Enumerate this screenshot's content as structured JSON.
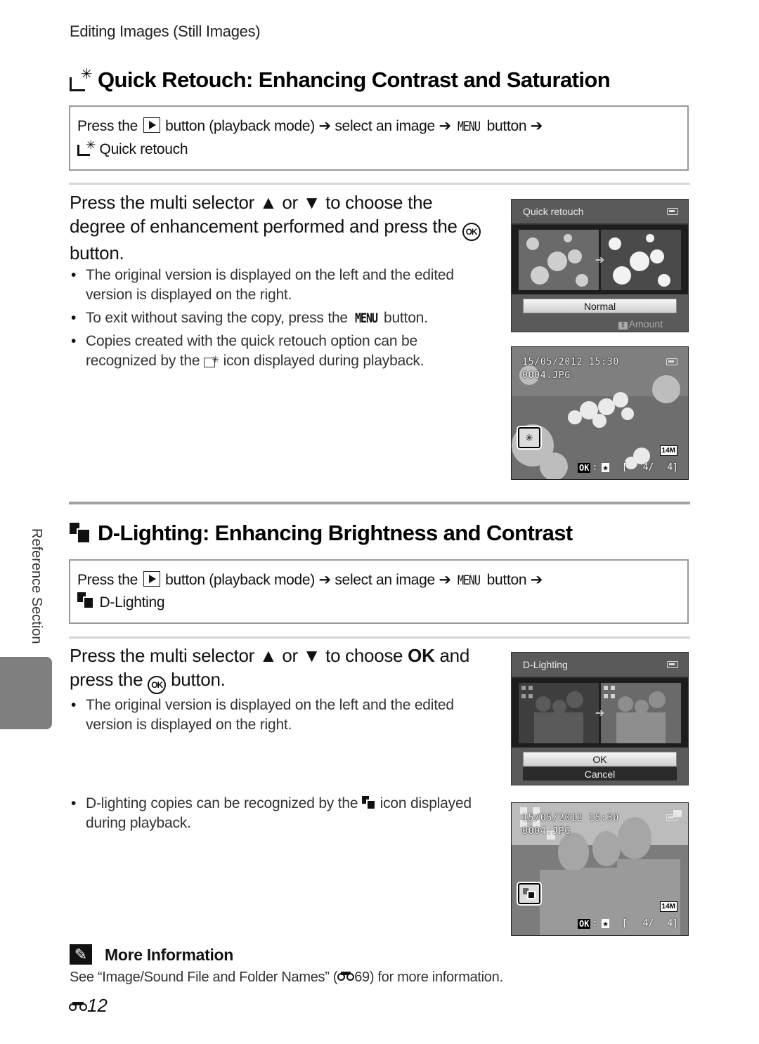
{
  "running_head": "Editing Images (Still Images)",
  "side_tab": {
    "label": "Reference Section",
    "color": "#7f7f7f"
  },
  "sections": [
    {
      "title": "Quick Retouch: Enhancing Contrast and Saturation",
      "title_icon": "quick-retouch-icon",
      "path": {
        "prefix": "Press the",
        "play_icon": "playback-button-icon",
        "part1": "button (playback mode)",
        "arrow": "➔",
        "part2": "select an image",
        "menu_word": "MENU",
        "part3": "button",
        "final_item": "Quick retouch"
      },
      "step": {
        "text_a": "Press the multi selector",
        "up": "▲",
        "or": "or",
        "down": "▼",
        "text_b": "to choose the degree of enhancement performed and press the",
        "ok": "OK",
        "text_c": "button."
      },
      "bullets": [
        {
          "text": "The original version is displayed on the left and the edited version is displayed on the right."
        },
        {
          "before": "To exit without saving the copy, press the",
          "menu_word": "MENU",
          "after": "button."
        },
        {
          "before": "Copies created with the quick retouch option can be recognized by the",
          "icon": "quick-retouch-playback-icon",
          "after": "icon displayed during playback."
        }
      ],
      "lcd_menu": {
        "title": "Quick retouch",
        "option": "Normal",
        "hint_icon": "up-down-icon",
        "hint": "Amount"
      },
      "playback": {
        "datetime": "15/05/2012 15:30",
        "filename": "0004.JPG",
        "image_size": "14M",
        "ok_label": "OK",
        "counter_open": "[",
        "counter_current": "4/",
        "counter_total": "4]"
      }
    },
    {
      "title": "D-Lighting: Enhancing Brightness and Contrast",
      "title_icon": "d-lighting-icon",
      "path": {
        "prefix": "Press the",
        "play_icon": "playback-button-icon",
        "part1": "button (playback mode)",
        "arrow": "➔",
        "part2": "select an image",
        "menu_word": "MENU",
        "part3": "button",
        "final_item": "D-Lighting"
      },
      "step": {
        "text_a": "Press the multi selector",
        "up": "▲",
        "or": "or",
        "down": "▼",
        "text_b": "to choose",
        "bold": "OK",
        "text_c": "and press the",
        "ok": "OK",
        "text_d": "button."
      },
      "bullets": [
        {
          "text": "The original version is displayed on the left and the edited version is displayed on the right."
        },
        {
          "before": "D-lighting copies can be recognized by the",
          "icon": "d-lighting-playback-icon",
          "after": "icon displayed during playback."
        }
      ],
      "lcd_menu": {
        "title": "D-Lighting",
        "options": [
          "OK",
          "Cancel"
        ],
        "selected": "OK"
      },
      "playback": {
        "datetime": "15/05/2012 15:30",
        "filename": "0004.JPG",
        "image_size": "14M",
        "ok_label": "OK",
        "counter_open": "[",
        "counter_current": "4/",
        "counter_total": "4]"
      }
    }
  ],
  "more_info": {
    "title": "More Information",
    "text_before": "See “Image/Sound File and Folder Names” (",
    "ref_page": "69",
    "text_after": ") for more information."
  },
  "page_number": "12"
}
